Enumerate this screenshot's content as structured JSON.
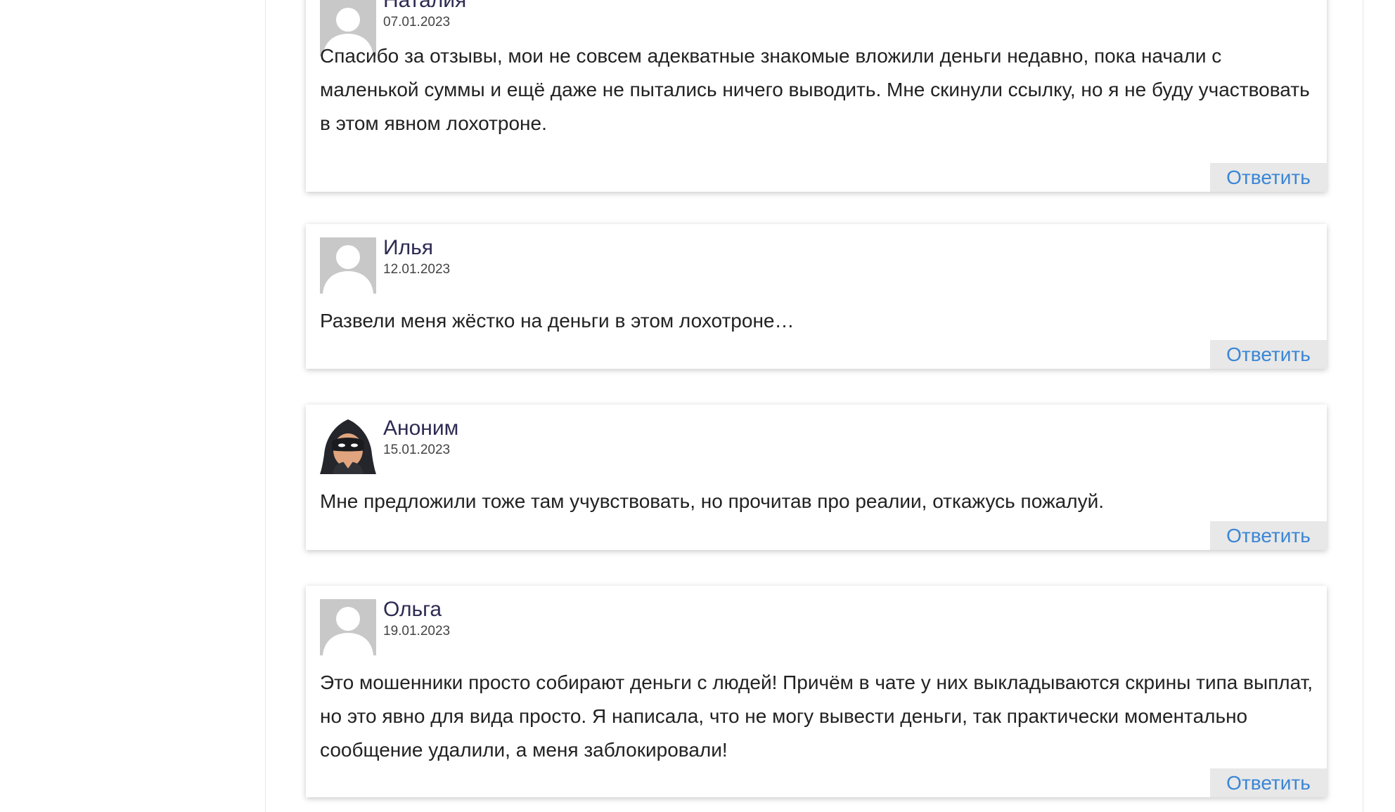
{
  "comments": [
    {
      "author": "Наталия",
      "date": "07.01.2023",
      "text": "Спасибо за отзывы, мои не совсем адекватные знакомые вложили деньги недавно, пока начали с маленькой суммы и ещё даже не пытались ничего выводить. Мне скинули ссылку, но я не буду участвовать в этом явном лохотроне.",
      "reply_label": "Ответить",
      "avatar": "default-avatar"
    },
    {
      "author": "Илья",
      "date": "12.01.2023",
      "text": "Развели меня жёстко на деньги в этом лохотроне…",
      "reply_label": "Ответить",
      "avatar": "default-avatar"
    },
    {
      "author": "Аноним",
      "date": "15.01.2023",
      "text": "Мне предложили тоже там учувствовать, но прочитав про реалии, откажусь пожалуй.",
      "reply_label": "Ответить",
      "avatar": "hooded-thief-avatar"
    },
    {
      "author": "Ольга",
      "date": "19.01.2023",
      "text": "Это мошенники просто собирают деньги с людей! Причём в чате у них выкладываются скрины типа выплат, но это явно для вида просто. Я написала, что не могу вывести деньги, так практически моментально сообщение удалили, а меня заблокировали!",
      "reply_label": "Ответить",
      "avatar": "default-avatar"
    }
  ],
  "colors": {
    "author": "#2e2a52",
    "reply_link": "#3a86d6",
    "reply_bg": "#e8e8e8",
    "body_text": "#222222"
  }
}
